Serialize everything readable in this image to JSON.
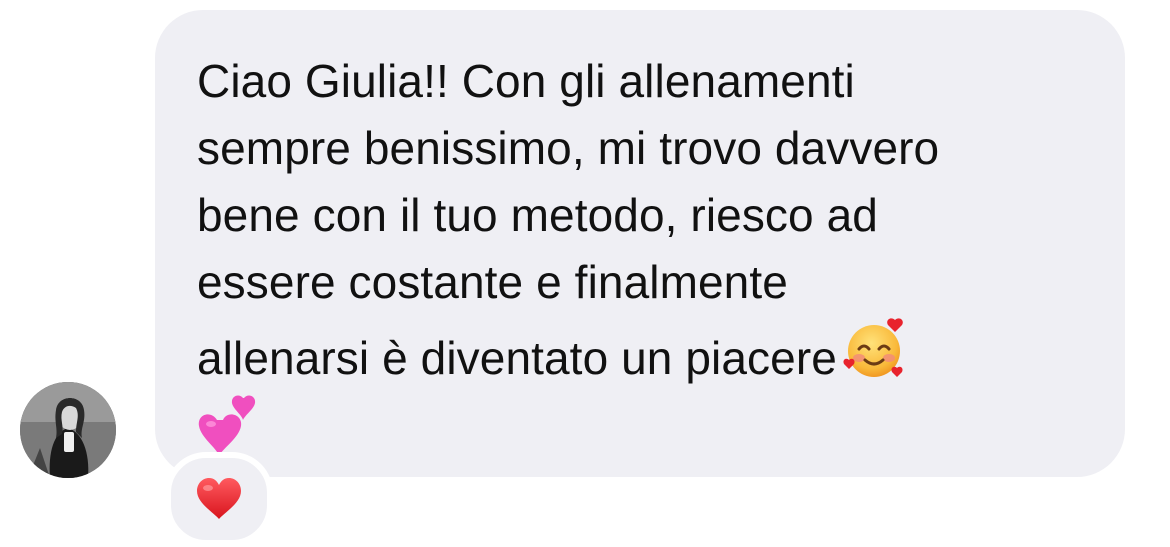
{
  "message": {
    "lines": [
      "Ciao Giulia!! Con gli allenamenti",
      "sempre benissimo, mi trovo davvero",
      "bene con il tuo metodo, riesco ad",
      "essere costante e finalmente",
      "allenarsi è diventato un piacere"
    ],
    "emojis": [
      "smiling-face-with-hearts-emoji",
      "two-hearts-emoji"
    ]
  },
  "reaction": {
    "emoji": "red-heart-emoji"
  },
  "colors": {
    "bubble": "#efeff4",
    "text": "#111111",
    "heart_red": "#e8232d",
    "pink_heart": "#f04fbf"
  }
}
